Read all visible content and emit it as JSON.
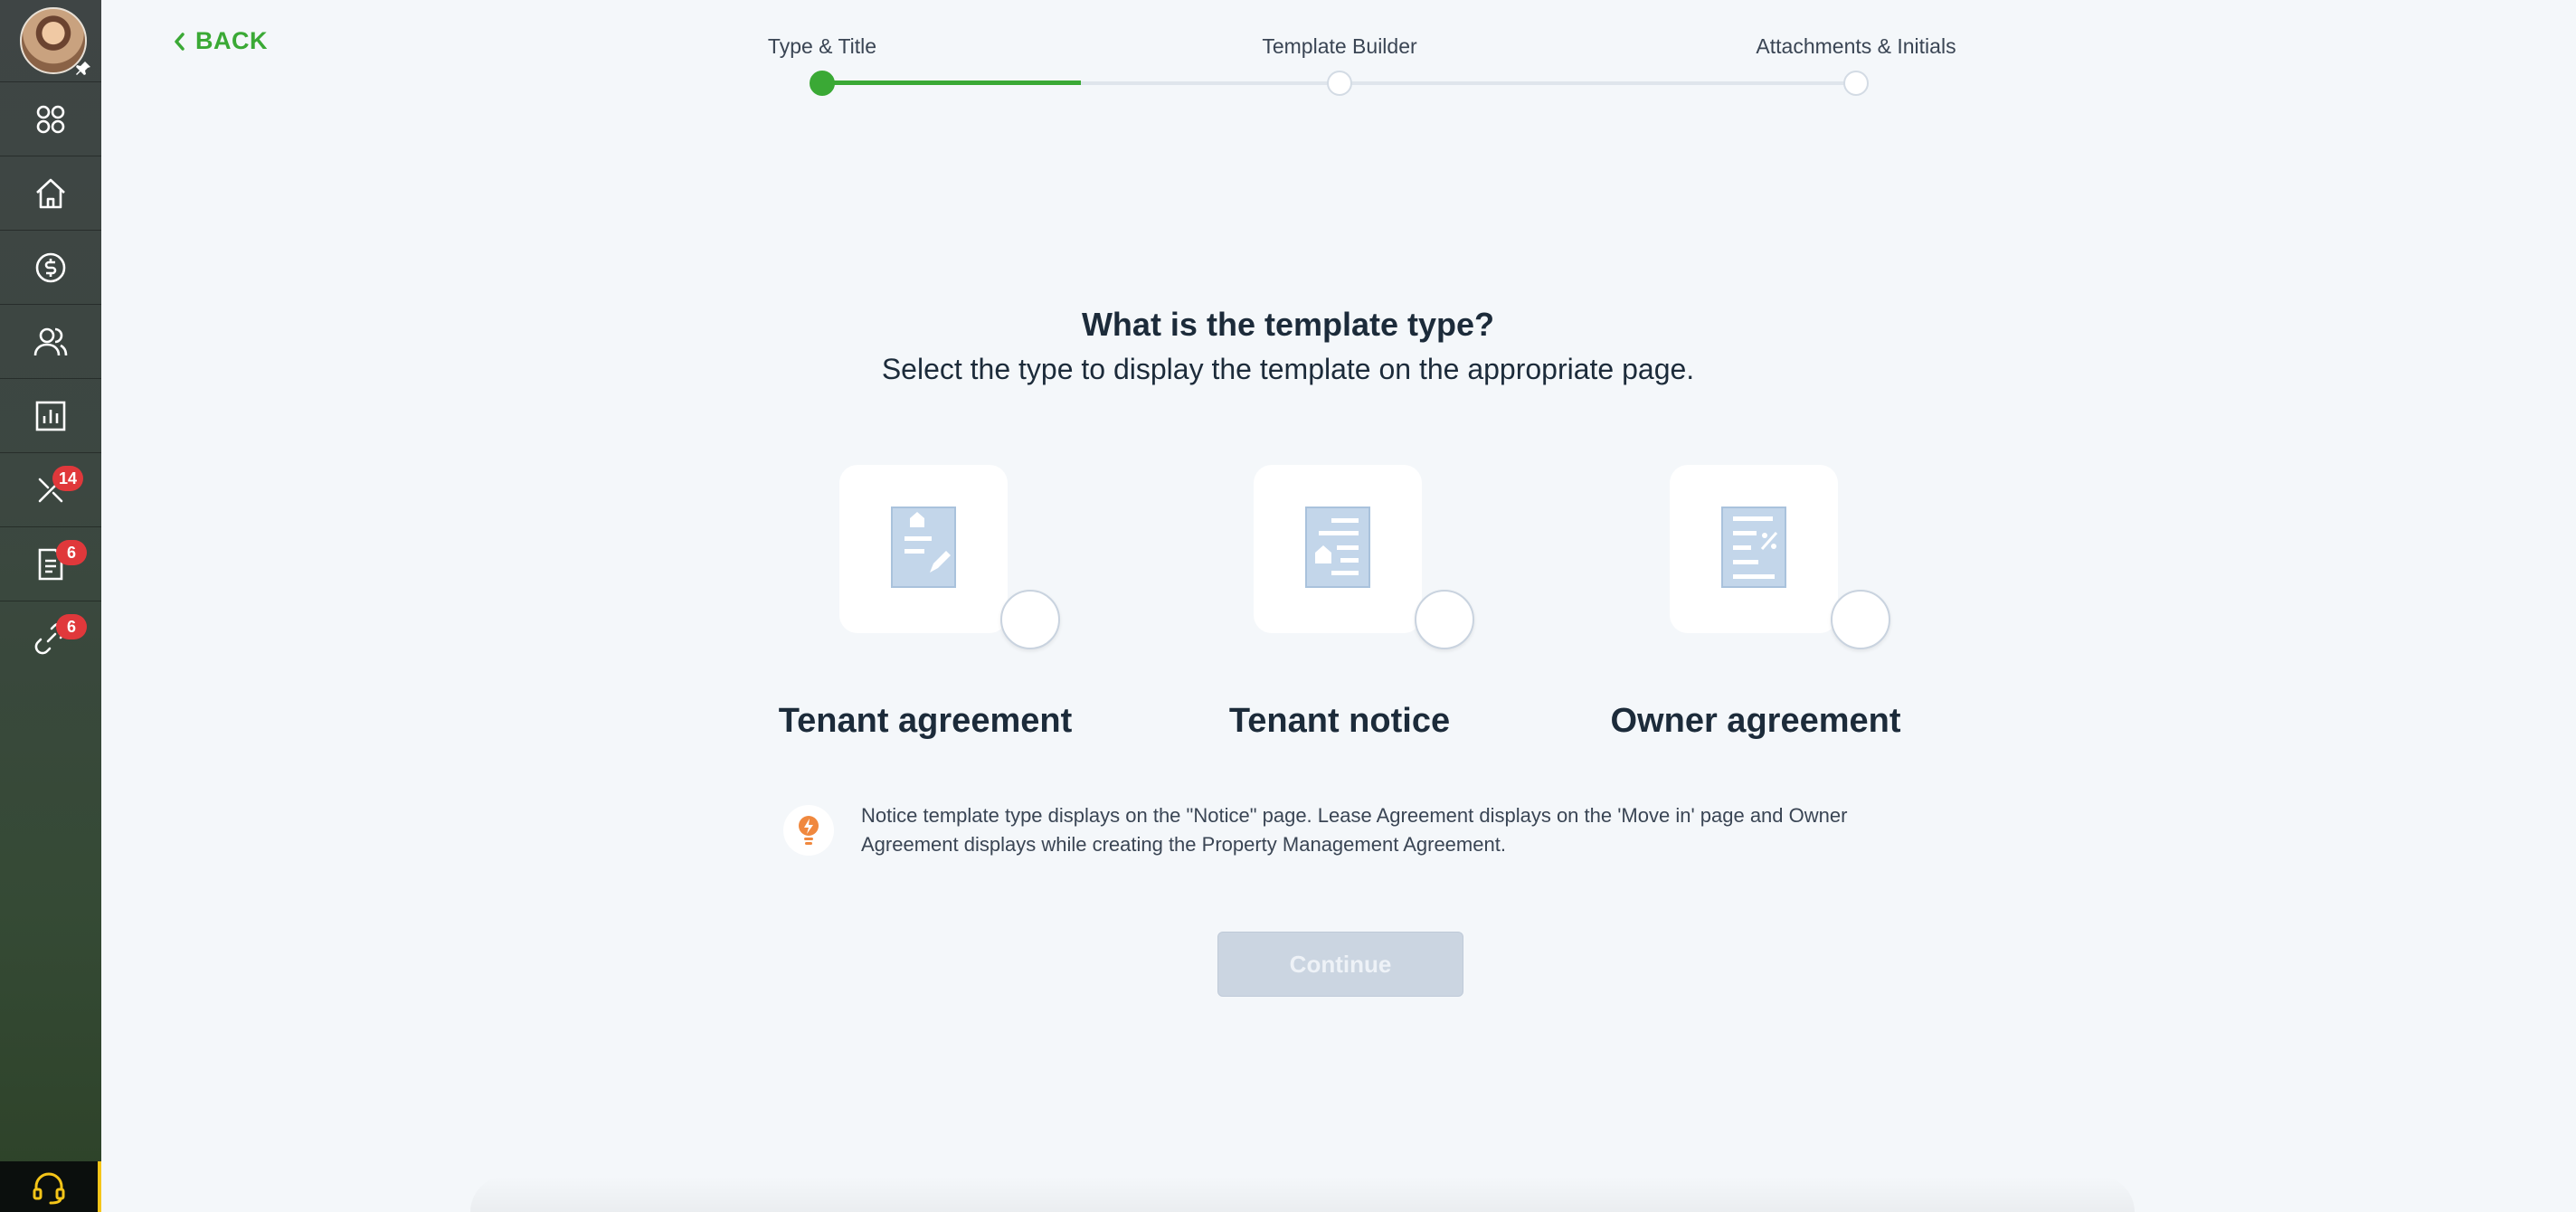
{
  "back": {
    "label": "BACK"
  },
  "stepper": {
    "steps": [
      {
        "label": "Type & Title",
        "state": "active"
      },
      {
        "label": "Template Builder",
        "state": "pending"
      },
      {
        "label": "Attachments & Initials",
        "state": "pending"
      }
    ],
    "progress_fraction": 0.25
  },
  "sidebar": {
    "items": [
      {
        "name": "apps",
        "icon": "apps-icon"
      },
      {
        "name": "home",
        "icon": "home-icon"
      },
      {
        "name": "payments",
        "icon": "dollar-icon"
      },
      {
        "name": "people",
        "icon": "people-icon"
      },
      {
        "name": "reports",
        "icon": "chart-icon"
      },
      {
        "name": "maintenance",
        "icon": "tools-icon",
        "badge": "14"
      },
      {
        "name": "documents",
        "icon": "document-icon",
        "badge": "6"
      },
      {
        "name": "integrations",
        "icon": "link-icon",
        "badge": "6"
      }
    ],
    "support_icon": "headset-icon"
  },
  "main": {
    "title": "What is the template type?",
    "subtitle": "Select the type to display the template on the appropriate page.",
    "options": [
      {
        "label": "Tenant agreement",
        "icon": "agreement-doc-icon",
        "selected": false
      },
      {
        "label": "Tenant notice",
        "icon": "notice-doc-icon",
        "selected": false
      },
      {
        "label": "Owner agreement",
        "icon": "owner-doc-icon",
        "selected": false
      }
    ],
    "info_text": "Notice template type displays on the \"Notice\" page. Lease Agreement displays on the 'Move in' page and Owner Agreement displays while creating the Property Management Agreement.",
    "continue_label": "Continue"
  },
  "colors": {
    "accent_green": "#3aa935",
    "badge_red": "#e0383b",
    "doc_icon_blue": "#c3d6ea",
    "info_orange": "#f0883e",
    "button_disabled": "#cbd5e1"
  }
}
